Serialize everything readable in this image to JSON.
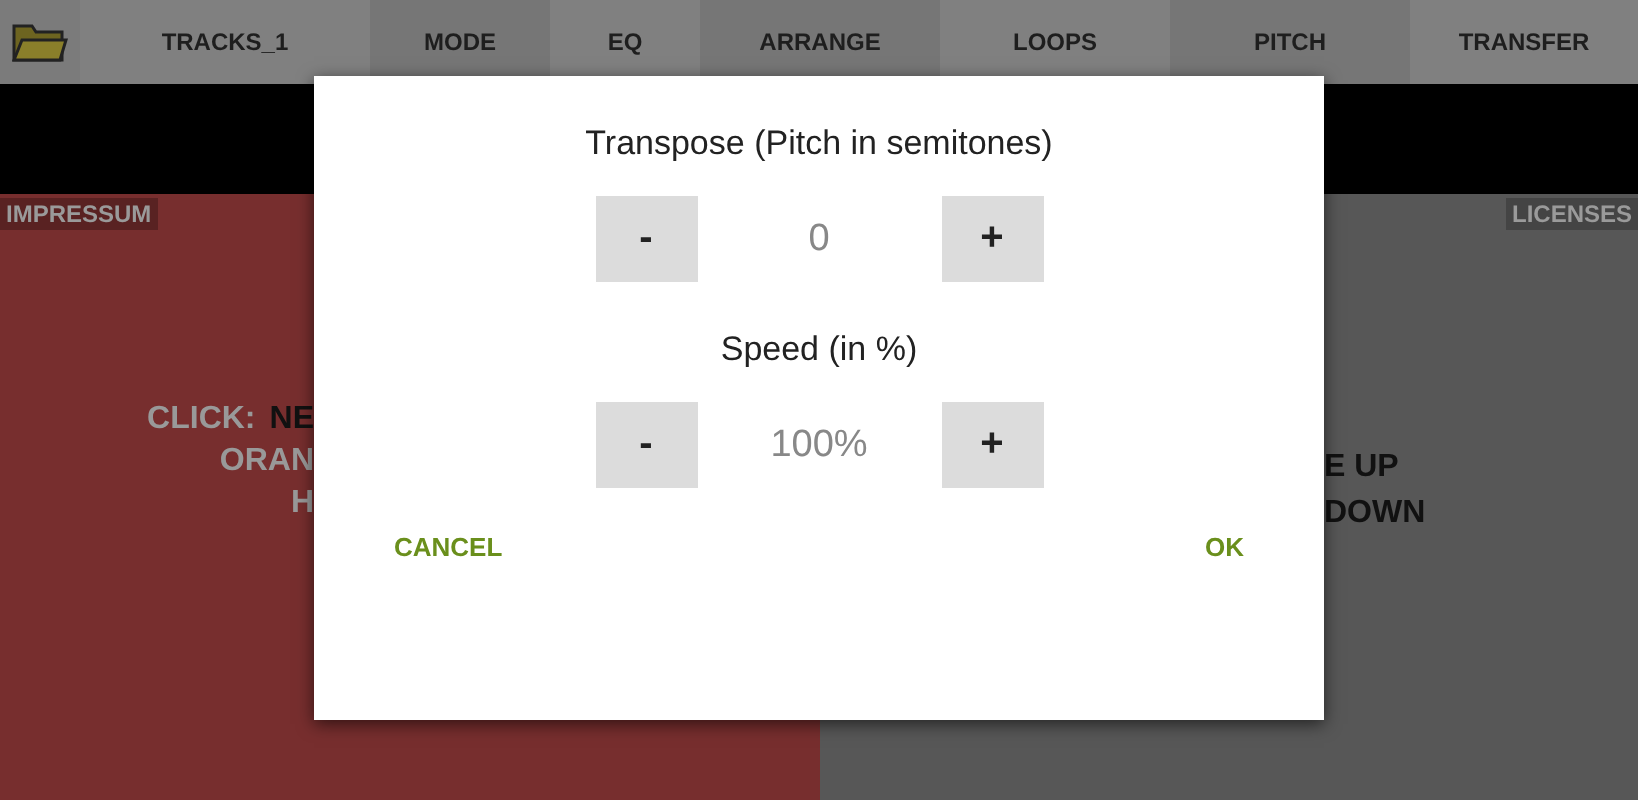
{
  "toolbar": {
    "tabs": [
      {
        "label": "TRACKS_1"
      },
      {
        "label": "MODE"
      },
      {
        "label": "EQ"
      },
      {
        "label": "ARRANGE"
      },
      {
        "label": "LOOPS"
      },
      {
        "label": "PITCH"
      },
      {
        "label": "TRANSFER"
      }
    ]
  },
  "left_panel": {
    "label": "IMPRESSUM",
    "lines": [
      [
        "CLICK:",
        "NE"
      ],
      [
        "ORAN"
      ],
      [
        "H"
      ]
    ]
  },
  "right_panel": {
    "label": "LICENSES",
    "lines": [
      "E UP",
      "DOWN"
    ]
  },
  "dialog": {
    "controls": [
      {
        "title": "Transpose (Pitch in semitones)",
        "minus": "-",
        "value": "0",
        "plus": "+"
      },
      {
        "title": "Speed (in %)",
        "minus": "-",
        "value": "100%",
        "plus": "+"
      }
    ],
    "cancel": "CANCEL",
    "ok": "OK"
  }
}
